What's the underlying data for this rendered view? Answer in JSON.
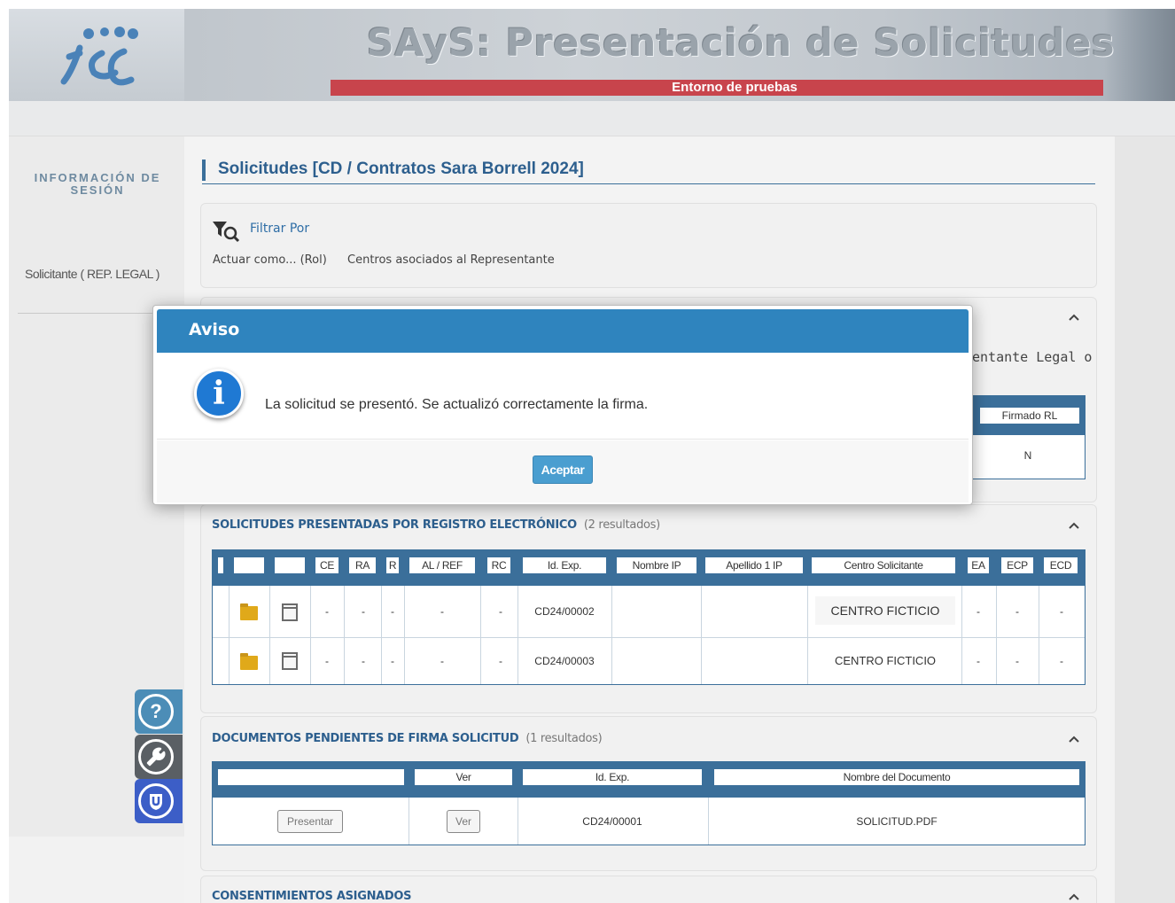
{
  "header": {
    "app_title": "SAyS: Presentación de Solicitudes",
    "environment": "Entorno de pruebas",
    "logo_text": "isc"
  },
  "sidebar": {
    "session_title": "INFORMACIÓN DE SESIÓN",
    "role": "Solicitante ( REP. LEGAL )",
    "help_icon": "question-icon",
    "tools_icon": "wrench-icon",
    "shield_icon": "shield-icon"
  },
  "main": {
    "page_title": "Solicitudes [CD / Contratos Sara Borrell 2024]",
    "filter": {
      "link_label": "Filtrar Por",
      "role_label": "Actuar como... (Rol)",
      "role_value": "Centros asociados al Representante"
    },
    "hidden_section": {
      "partial_text": "entante Legal o",
      "column": "Firmado RL",
      "value": "N"
    },
    "presented": {
      "title": "SOLICITUDES PRESENTADAS POR REGISTRO ELECTRÓNICO",
      "count": "(2 resultados)",
      "columns": [
        "",
        "",
        "",
        "CE",
        "RA",
        "R",
        "AL / REF",
        "RC",
        "Id. Exp.",
        "Nombre IP",
        "Apellido 1 IP",
        "Centro Solicitante",
        "EA",
        "ECP",
        "ECD"
      ],
      "rows": [
        {
          "ce": "-",
          "ra": "-",
          "r": "-",
          "al": "-",
          "rc": "-",
          "id": "CD24/00002",
          "nombre": "",
          "apellido": "",
          "centro": "CENTRO FICTICIO",
          "ea": "-",
          "ecp": "-",
          "ecd": "-"
        },
        {
          "ce": "-",
          "ra": "-",
          "r": "-",
          "al": "-",
          "rc": "-",
          "id": "CD24/00003",
          "nombre": "",
          "apellido": "",
          "centro": "CENTRO FICTICIO",
          "ea": "-",
          "ecp": "-",
          "ecd": "-"
        }
      ]
    },
    "pending": {
      "title": "DOCUMENTOS PENDIENTES DE FIRMA SOLICITUD",
      "count": "(1 resultados)",
      "columns": [
        "",
        "Ver",
        "Id. Exp.",
        "Nombre del Documento"
      ],
      "row": {
        "present_button": "Presentar",
        "view_button": "Ver",
        "id": "CD24/00001",
        "document": "SOLICITUD.PDF"
      }
    },
    "consents": {
      "title": "CONSENTIMIENTOS ASIGNADOS"
    }
  },
  "modal": {
    "title": "Aviso",
    "icon": "info-icon",
    "message": "La solicitud se presentó. Se actualizó correctamente la firma.",
    "accept_label": "Aceptar"
  },
  "colors": {
    "header_blue": "#2f84be",
    "grid_blue": "#3b6f9a",
    "environment_red": "#c8444c",
    "accept_blue": "#4a9ed0",
    "folder_yellow": "#e0a91a"
  }
}
